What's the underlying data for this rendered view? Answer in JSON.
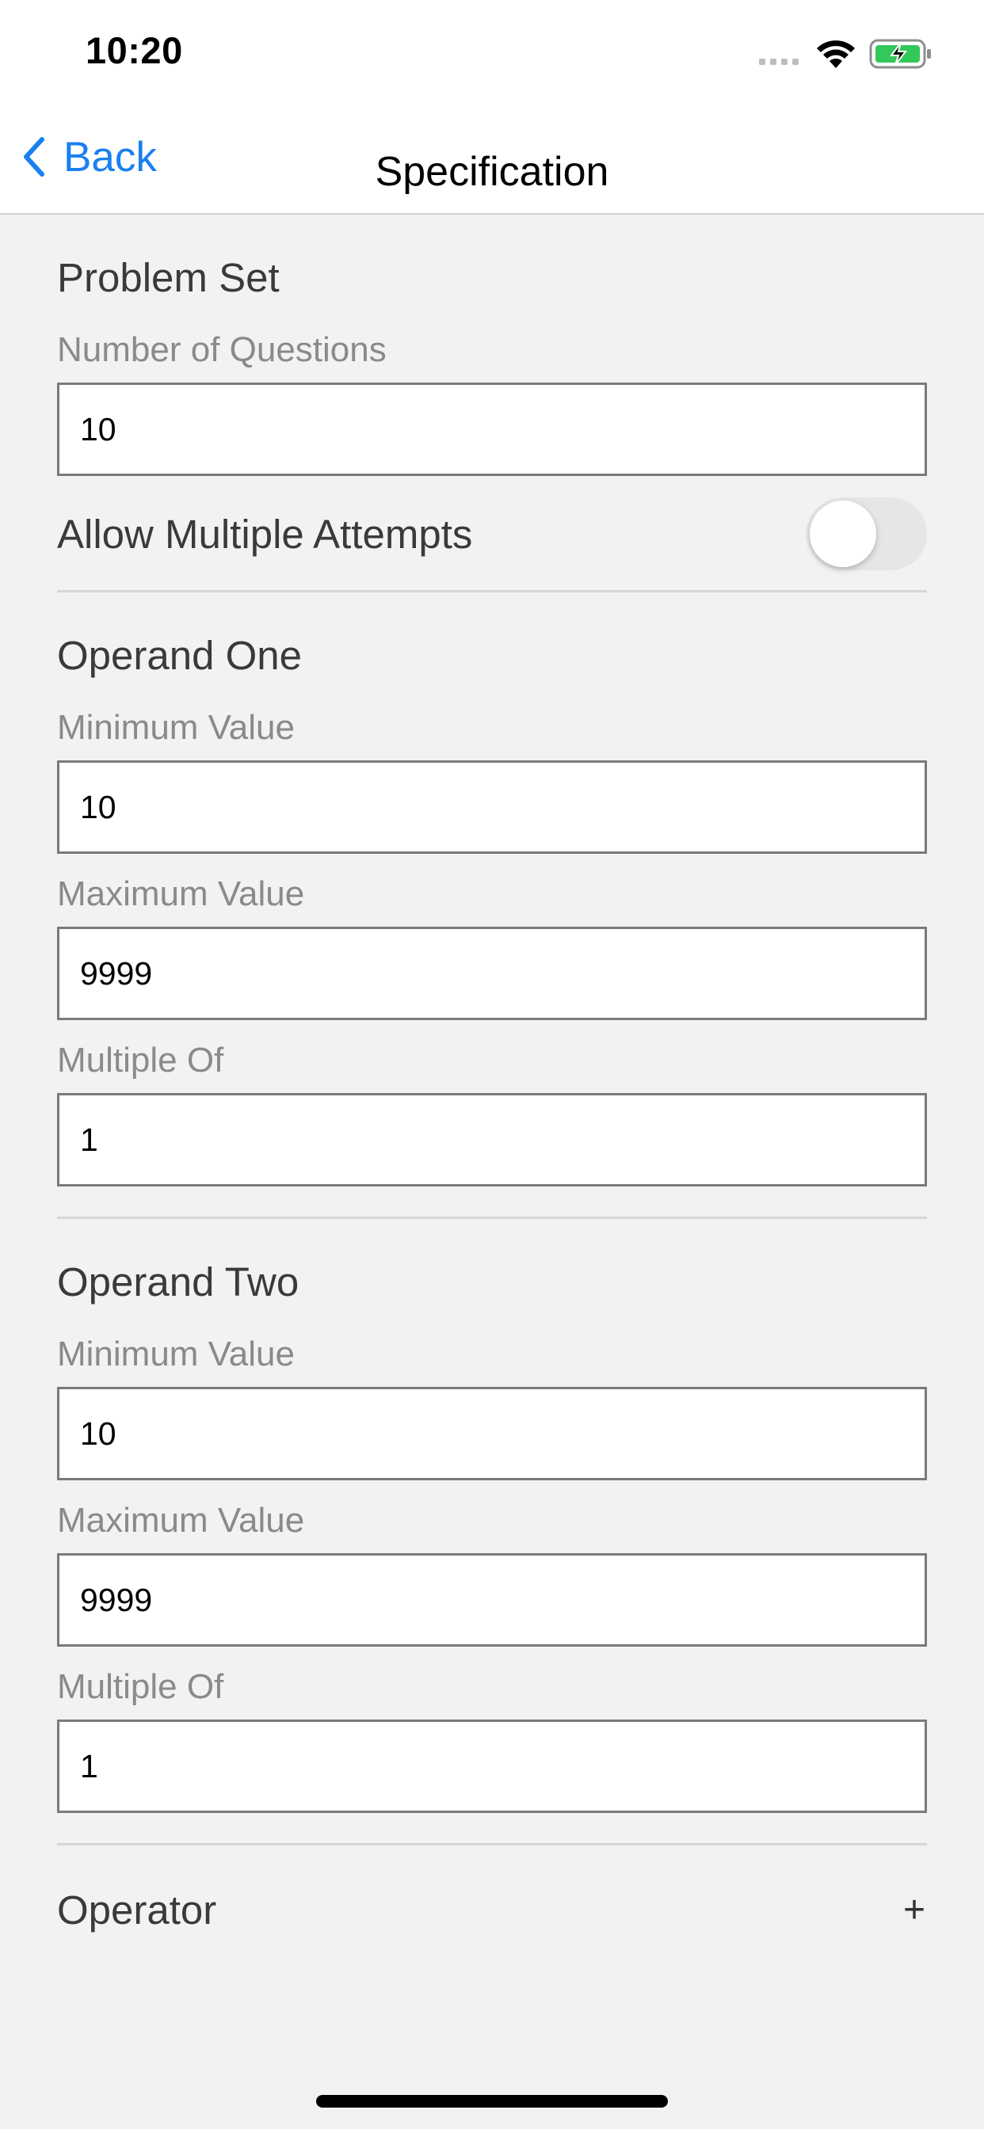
{
  "status_bar": {
    "time": "10:20",
    "battery_color": "#34c759"
  },
  "nav": {
    "back_label": "Back",
    "title": "Specification"
  },
  "problem_set": {
    "title": "Problem Set",
    "num_questions_label": "Number of Questions",
    "num_questions_value": "10",
    "multiple_attempts_label": "Allow Multiple Attempts",
    "multiple_attempts_on": false
  },
  "operand_one": {
    "title": "Operand One",
    "min_label": "Minimum Value",
    "min_value": "10",
    "max_label": "Maximum Value",
    "max_value": "9999",
    "multiple_label": "Multiple Of",
    "multiple_value": "1"
  },
  "operand_two": {
    "title": "Operand Two",
    "min_label": "Minimum Value",
    "min_value": "10",
    "max_label": "Maximum Value",
    "max_value": "9999",
    "multiple_label": "Multiple Of",
    "multiple_value": "1"
  },
  "operator": {
    "label": "Operator",
    "value": "+"
  }
}
